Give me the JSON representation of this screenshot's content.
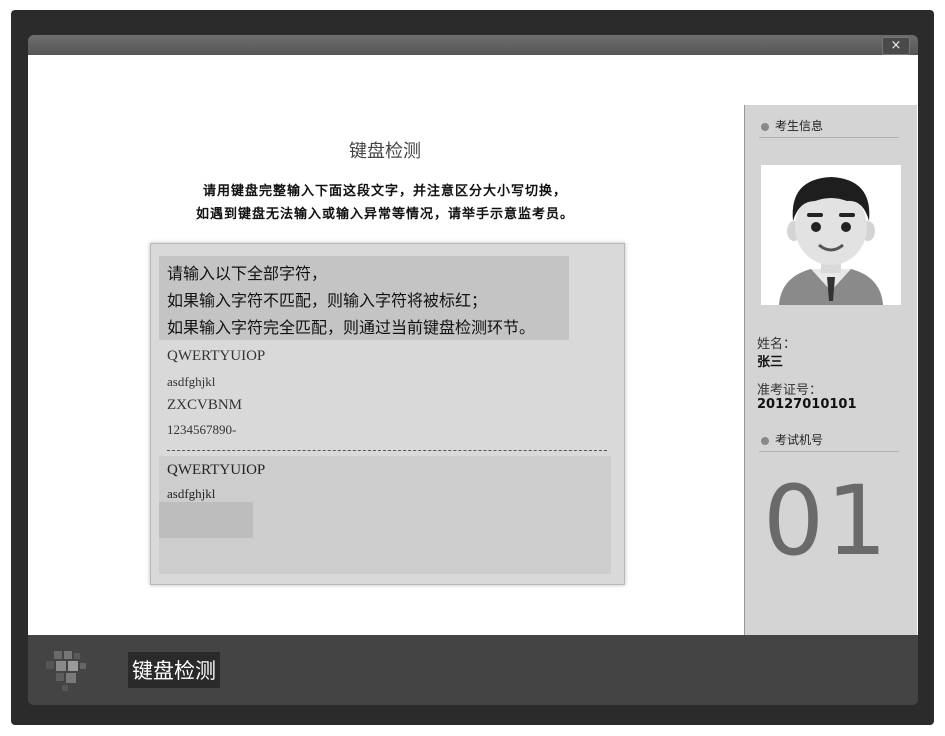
{
  "window": {
    "close_label": "×"
  },
  "main": {
    "heading": "键盘检测",
    "instruction_line1": "请用键盘完整输入下面这段文字，并注意区分大小写切换，",
    "instruction_line2": "如遇到键盘无法输入或输入异常等情况，请举手示意监考员。"
  },
  "prompt": {
    "lines": [
      "请输入以下全部字符，",
      "如果输入字符不匹配，则输入字符将被标红；",
      "如果输入字符完全匹配，则通过当前键盘检测环节。"
    ]
  },
  "reference_text": [
    "QWERTYUIOP",
    "asdfghjkl",
    "ZXCVBNM",
    "1234567890-"
  ],
  "typed_text": [
    "QWERTYUIOP",
    "asdfghjkl"
  ],
  "sidebar": {
    "candidate_info_title": "考生信息",
    "name_label": "姓名：",
    "name_value": "张三",
    "id_label": "准考证号：",
    "id_value": "20127010101",
    "machine_title": "考试机号",
    "machine_number": "01"
  },
  "footer": {
    "title": "键盘检测"
  },
  "icons": [
    "close-icon",
    "bullet-icon",
    "avatar",
    "logo-icon"
  ],
  "colors": {
    "footer_bg": "#444444",
    "sidebar_bg": "#d4d4d4",
    "panel_bg": "#d9d9d9"
  }
}
